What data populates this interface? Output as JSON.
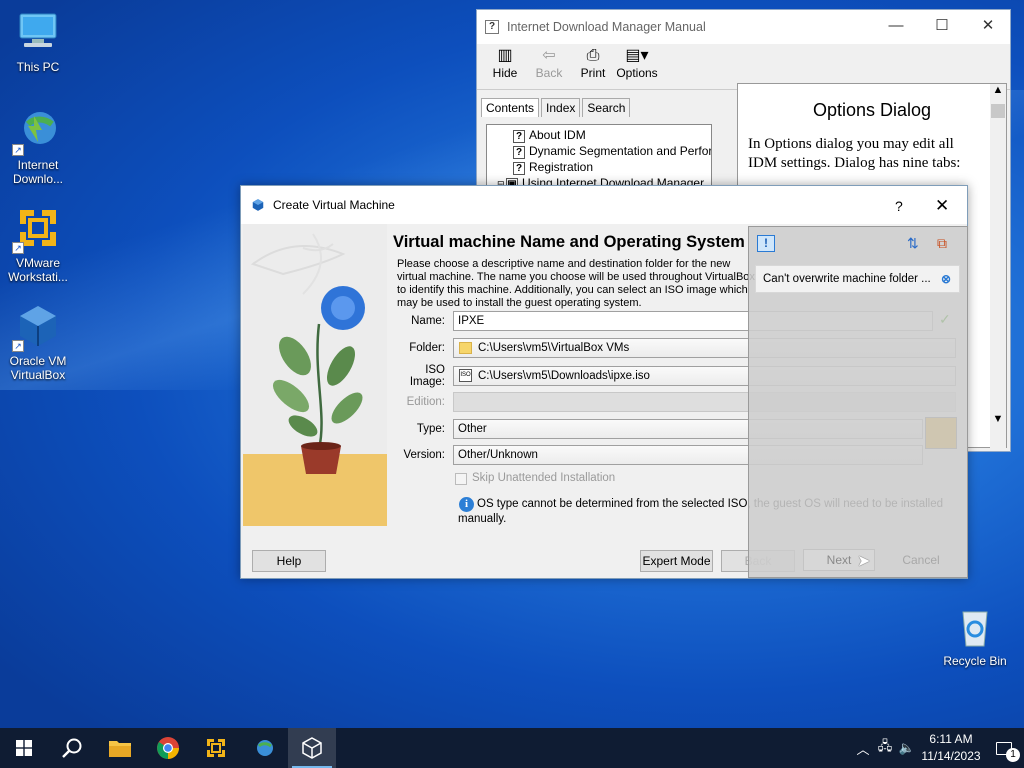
{
  "desktop": {
    "icons": [
      {
        "label": "This PC"
      },
      {
        "label": "Internet Downlo..."
      },
      {
        "label": "VMware Workstati..."
      },
      {
        "label": "Oracle VM VirtualBox"
      },
      {
        "label": "Recycle Bin"
      }
    ]
  },
  "idm_help": {
    "title": "Internet Download Manager Manual",
    "toolbar": {
      "hide": "Hide",
      "back": "Back",
      "print": "Print",
      "options": "Options"
    },
    "tabs": [
      "Contents",
      "Index",
      "Search"
    ],
    "tree": [
      "About IDM",
      "Dynamic Segmentation and Performar",
      "Registration",
      "Using Internet Download Manager"
    ],
    "heading": "Options Dialog",
    "body": "In Options dialog you may edit all IDM settings. Dialog has nine tabs:"
  },
  "vbox": {
    "title": "Create Virtual Machine",
    "help_glyph": "?",
    "heading": "Virtual machine Name and Operating System",
    "description": "Please choose a descriptive name and destination folder for the new virtual machine. The name you choose will be used throughout VirtualBox to identify this machine. Additionally, you can select an ISO image which may be used to install the guest operating system.",
    "fields": {
      "name_label": "Name:",
      "name_value": "IPXE",
      "folder_label": "Folder:",
      "folder_value": "C:\\Users\\vm5\\VirtualBox VMs",
      "iso_label": "ISO Image:",
      "iso_value": "C:\\Users\\vm5\\Downloads\\ipxe.iso",
      "edition_label": "Edition:",
      "type_label": "Type:",
      "type_value": "Other",
      "version_label": "Version:",
      "version_value": "Other/Unknown"
    },
    "skip_unattended": "Skip Unattended Installation",
    "info_line1": "OS type cannot be determined from the selected ISO, the guest OS will need to be installed",
    "info_line2": "manually.",
    "buttons": {
      "help": "Help",
      "expert": "Expert Mode",
      "back": "Back",
      "next": "Next",
      "cancel": "Cancel"
    },
    "overlay_message": "Can't overwrite machine folder ..."
  },
  "taskbar": {
    "time": "6:11 AM",
    "date": "11/14/2023",
    "notification_count": "1"
  },
  "colors": {
    "accent": "#0078d7",
    "taskbar": "#0f1c33",
    "vbox_blue": "#2b64c4"
  }
}
